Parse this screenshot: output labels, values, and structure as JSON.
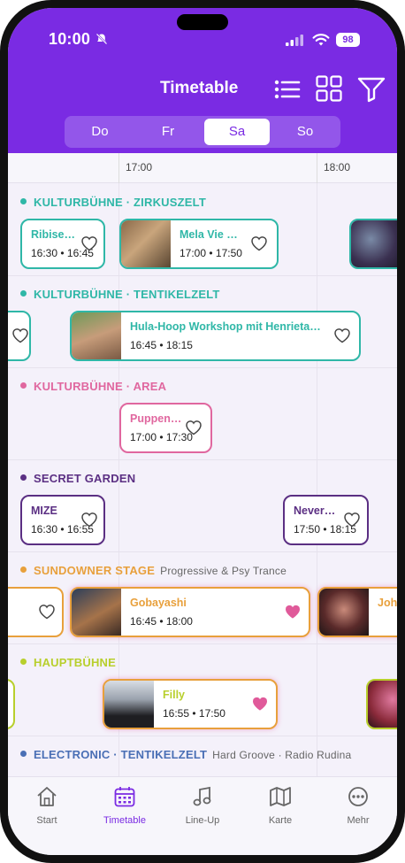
{
  "status": {
    "time": "10:00",
    "battery": "98"
  },
  "header": {
    "title": "Timetable",
    "icons": [
      "list-icon",
      "grid-icon",
      "filter-icon"
    ]
  },
  "days": [
    {
      "label": "Do",
      "active": false
    },
    {
      "label": "Fr",
      "active": false
    },
    {
      "label": "Sa",
      "active": true
    },
    {
      "label": "So",
      "active": false
    }
  ],
  "timeline": {
    "labels": [
      "17:00",
      "18:00"
    ]
  },
  "stages": [
    {
      "name": "KULTURBÜHNE · ZIRKUSZELT",
      "sub": "",
      "color": "#2fb7a7",
      "events": [
        {
          "name": "Ribise…",
          "time": "16:30 • 16:45",
          "liked": false
        },
        {
          "name": "Mela Vie …",
          "time": "17:00 • 17:50",
          "liked": false
        }
      ]
    },
    {
      "name": "KULTURBÜHNE · TENTIKELZELT",
      "sub": "",
      "color": "#2fb7a7",
      "events": [
        {
          "name": "Hula-Hoop Workshop mit Henrieta…",
          "time": "16:45 • 18:15",
          "liked": false
        }
      ]
    },
    {
      "name": "KULTURBÜHNE · AREA",
      "sub": "",
      "color": "#e0679f",
      "events": [
        {
          "name": "Puppen…",
          "time": "17:00 • 17:30",
          "liked": false
        }
      ]
    },
    {
      "name": "SECRET GARDEN",
      "sub": "",
      "color": "#5b2f83",
      "events": [
        {
          "name": "MIZE",
          "time": "16:30 • 16:55",
          "liked": false
        },
        {
          "name": "Never…",
          "time": "17:50 • 18:15",
          "liked": false
        }
      ]
    },
    {
      "name": "SUNDOWNER STAGE",
      "sub": "Progressive & Psy Trance",
      "color": "#e8a03c",
      "events": [
        {
          "name": "Gobayashi",
          "time": "16:45 • 18:00",
          "liked": true
        },
        {
          "name": "Joh",
          "time": "",
          "liked": false
        }
      ]
    },
    {
      "name": "HAUPTBÜHNE",
      "sub": "",
      "color": "#b8cf2c",
      "events": [
        {
          "name": "Filly",
          "time": "16:55 • 17:50",
          "liked": true
        }
      ]
    },
    {
      "name": "ELECTRONIC · TENTIKELZELT",
      "sub": "Hard Groove · Radio Rudina",
      "color": "#4a6fb5",
      "events": []
    }
  ],
  "tabs": [
    {
      "label": "Start",
      "icon": "home-icon",
      "active": false
    },
    {
      "label": "Timetable",
      "icon": "calendar-icon",
      "active": true
    },
    {
      "label": "Line-Up",
      "icon": "music-note-icon",
      "active": false
    },
    {
      "label": "Karte",
      "icon": "map-icon",
      "active": false
    },
    {
      "label": "Mehr",
      "icon": "more-icon",
      "active": false
    }
  ],
  "colors": {
    "brand": "#7a2be3",
    "heart_active": "#e05a9a"
  }
}
